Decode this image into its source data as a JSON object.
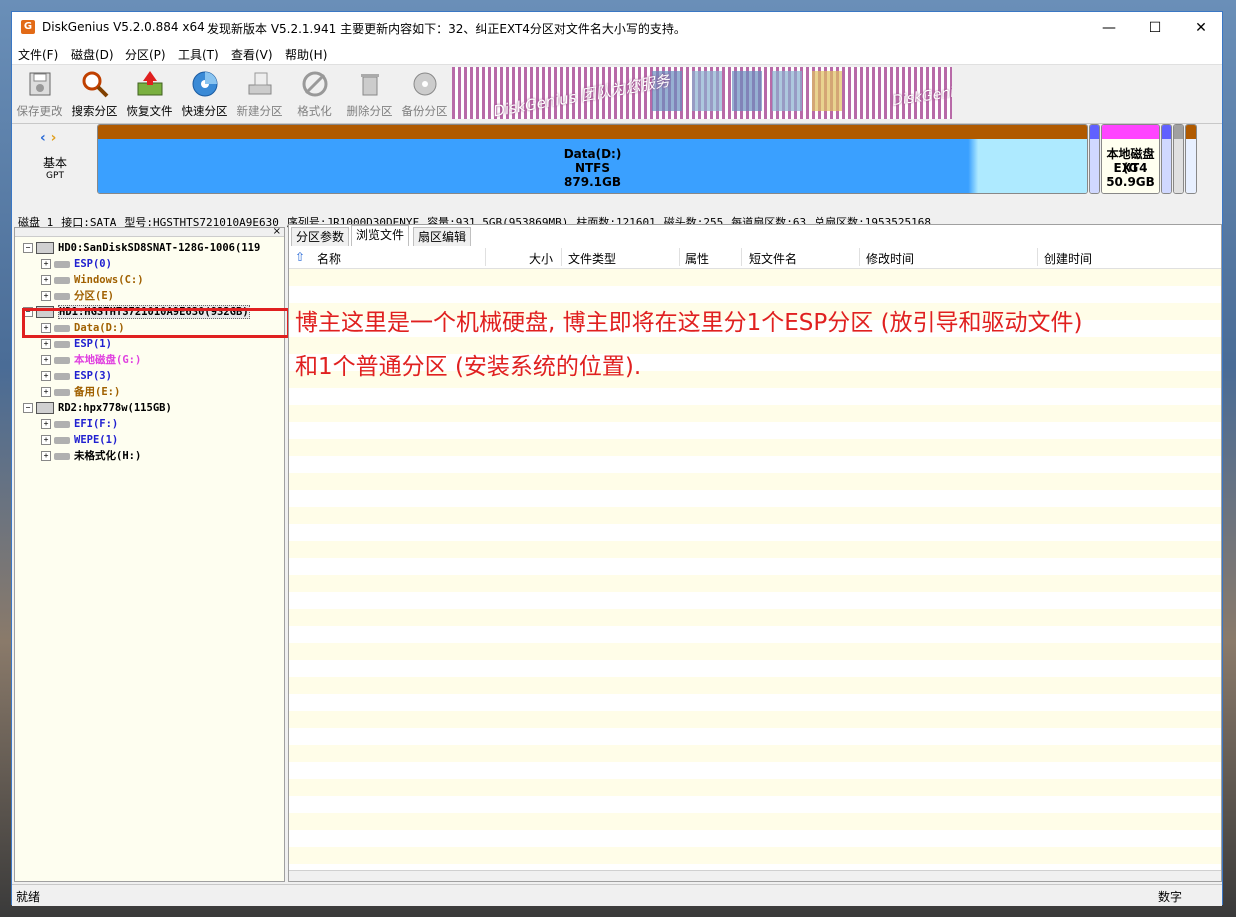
{
  "window": {
    "title": "DiskGenius V5.2.0.884 x64",
    "update_notice": "发现新版本 V5.2.1.941 主要更新内容如下：32、纠正EXT4分区对文件名大小写的支持。",
    "controls": {
      "minimize": "—",
      "maximize": "☐",
      "close": "✕"
    }
  },
  "menu": [
    "文件(F)",
    "磁盘(D)",
    "分区(P)",
    "工具(T)",
    "查看(V)",
    "帮助(H)"
  ],
  "toolbar": [
    {
      "label": "保存更改",
      "icon": "save-icon",
      "enabled": false
    },
    {
      "label": "搜索分区",
      "icon": "search-partition-icon",
      "enabled": true
    },
    {
      "label": "恢复文件",
      "icon": "recover-file-icon",
      "enabled": true
    },
    {
      "label": "快速分区",
      "icon": "quick-partition-icon",
      "enabled": true
    },
    {
      "label": "新建分区",
      "icon": "new-partition-icon",
      "enabled": false
    },
    {
      "label": "格式化",
      "icon": "format-icon",
      "enabled": false
    },
    {
      "label": "删除分区",
      "icon": "delete-partition-icon",
      "enabled": false
    },
    {
      "label": "备份分区",
      "icon": "backup-partition-icon",
      "enabled": false
    }
  ],
  "banner": {
    "text_left": "DiskGenius 团队为您服务",
    "text_right": "DiskGeni"
  },
  "diskmap": {
    "disk_type": "基本",
    "disk_style": "GPT",
    "partitions": [
      {
        "name": "Data(D:)",
        "fs": "NTFS",
        "size": "879.1GB",
        "color": "#3399ff"
      },
      {
        "name": "本地磁盘(G",
        "fs": "EXT4",
        "size": "50.9GB",
        "color": "#ff44ff"
      }
    ]
  },
  "disk_info": {
    "disk": "磁盘 1",
    "interface": "接口:SATA",
    "model": "型号:HGSTHTS721010A9E630",
    "serial": "序列号:JR1000D30DENYF",
    "capacity": "容量:931.5GB(953869MB)",
    "cylinders": "柱面数:121601",
    "heads": "磁头数:255",
    "sectors_per_track": "每道扇区数:63",
    "total_sectors": "总扇区数:1953525168"
  },
  "tree": [
    {
      "label": "HD0:SanDiskSD8SNAT-128G-1006(119",
      "level": 0,
      "type": "disk",
      "color": "#000000"
    },
    {
      "label": "ESP(0)",
      "level": 1,
      "type": "part",
      "color": "#2020d0"
    },
    {
      "label": "Windows(C:)",
      "level": 1,
      "type": "part",
      "color": "#a06000"
    },
    {
      "label": "分区(E)",
      "level": 1,
      "type": "part",
      "color": "#a06000"
    },
    {
      "label": "HD1:HGSTHTS721010A9E630(932GB)",
      "level": 0,
      "type": "disk",
      "color": "#000000"
    },
    {
      "label": "Data(D:)",
      "level": 1,
      "type": "part",
      "color": "#a06000"
    },
    {
      "label": "ESP(1)",
      "level": 1,
      "type": "part",
      "color": "#2020d0"
    },
    {
      "label": "本地磁盘(G:)",
      "level": 1,
      "type": "part",
      "color": "#e040e0"
    },
    {
      "label": "ESP(3)",
      "level": 1,
      "type": "part",
      "color": "#2020d0"
    },
    {
      "label": "备用(E:)",
      "level": 1,
      "type": "part",
      "color": "#a06000"
    },
    {
      "label": "RD2:hpx778w(115GB)",
      "level": 0,
      "type": "disk",
      "color": "#000000"
    },
    {
      "label": "EFI(F:)",
      "level": 1,
      "type": "part",
      "color": "#2020d0"
    },
    {
      "label": "WEPE(1)",
      "level": 1,
      "type": "part",
      "color": "#2020d0"
    },
    {
      "label": "未格式化(H:)",
      "level": 1,
      "type": "part",
      "color": "#000000"
    }
  ],
  "tabs": [
    "分区参数",
    "浏览文件",
    "扇区编辑"
  ],
  "columns": [
    "名称",
    "大小",
    "文件类型",
    "属性",
    "短文件名",
    "修改时间",
    "创建时间"
  ],
  "annotation": [
    "博主这里是一个机械硬盘, 博主即将在这里分1个ESP分区 (放引导和驱动文件)",
    "和1个普通分区 (安装系统的位置)."
  ],
  "status": {
    "left": "就绪",
    "right": "数字"
  }
}
